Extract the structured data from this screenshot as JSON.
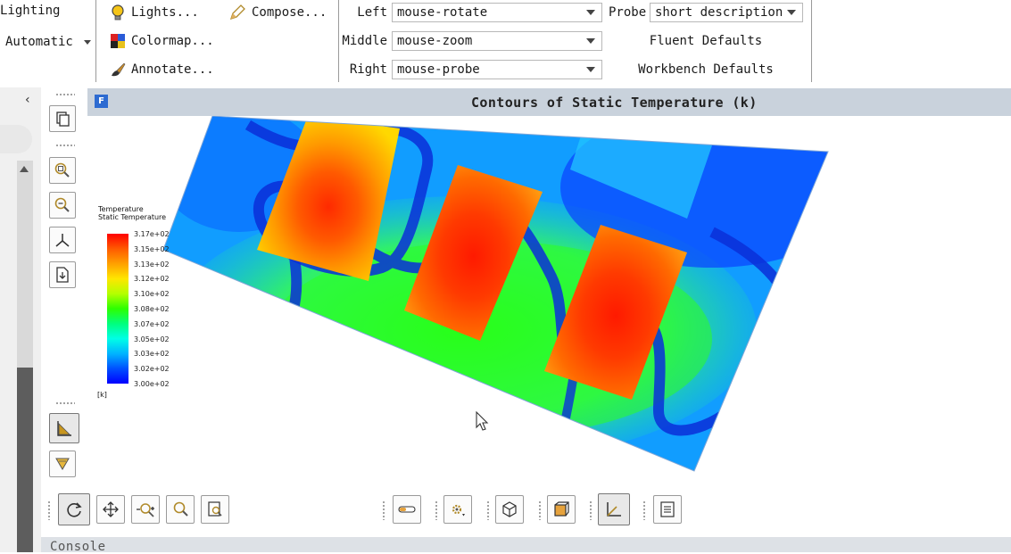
{
  "ribbon": {
    "lighting_label": "Lighting",
    "lighting_mode": "Automatic",
    "lights_label": "Lights...",
    "compose_label": "Compose...",
    "colormap_label": "Colormap...",
    "annotate_label": "Annotate...",
    "mouse": {
      "left_label": "Left",
      "left_value": "mouse-rotate",
      "middle_label": "Middle",
      "middle_value": "mouse-zoom",
      "right_label": "Right",
      "right_value": "mouse-probe",
      "probe_label": "Probe",
      "probe_value": "short description",
      "fluent_defaults": "Fluent Defaults",
      "workbench_defaults": "Workbench Defaults"
    }
  },
  "graphics": {
    "title": "Contours of Static Temperature (k)",
    "window_badge": "F"
  },
  "legend": {
    "title_line1": "Temperature",
    "title_line2": "Static Temperature",
    "unit": "[k]",
    "ticks": [
      "3.17e+02",
      "3.15e+02",
      "3.13e+02",
      "3.12e+02",
      "3.10e+02",
      "3.08e+02",
      "3.07e+02",
      "3.05e+02",
      "3.03e+02",
      "3.02e+02",
      "3.00e+02"
    ],
    "colors": [
      "#ff0000",
      "#ff5a00",
      "#ffa000",
      "#ffe600",
      "#b4ff00",
      "#2dff00",
      "#00ff7d",
      "#00ffe6",
      "#00b4ff",
      "#0050ff",
      "#0000ff"
    ]
  },
  "console": {
    "label": "Console"
  },
  "colors": {
    "ribbon_bg": "#ffffff",
    "header_bg": "#c9d2dc",
    "accent": "#2d6bd1"
  }
}
